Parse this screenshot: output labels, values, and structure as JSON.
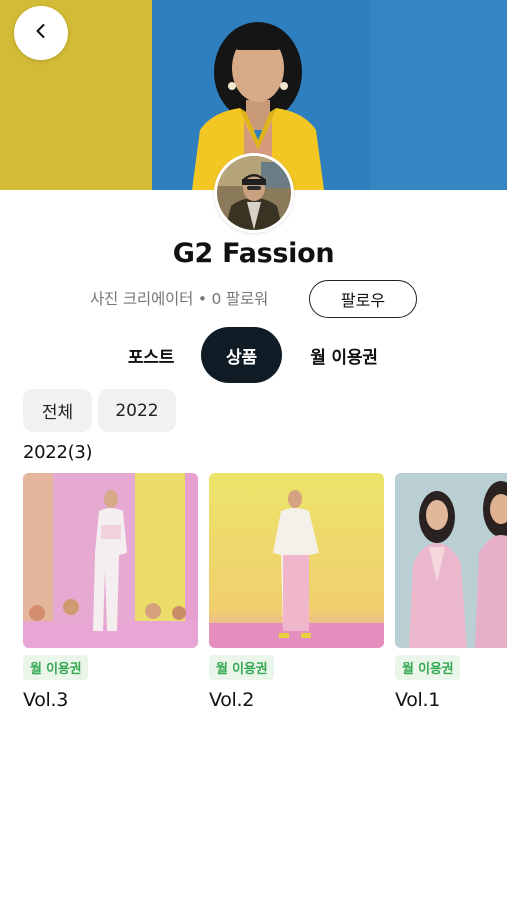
{
  "header": {
    "back_icon": "chevron-left-icon"
  },
  "profile": {
    "name": "G2 Fassion",
    "meta": "사진 크리에이터 • 0 팔로워",
    "follow_label": "팔로우"
  },
  "tabs": [
    {
      "label": "포스트",
      "active": false
    },
    {
      "label": "상품",
      "active": true
    },
    {
      "label": "월 이용권",
      "active": false
    }
  ],
  "filters": [
    {
      "label": "전체"
    },
    {
      "label": "2022"
    }
  ],
  "section": {
    "heading": "2022(3)"
  },
  "products": [
    {
      "badge": "월 이용권",
      "title": "Vol.3"
    },
    {
      "badge": "월 이용권",
      "title": "Vol.2"
    },
    {
      "badge": "월 이용권",
      "title": "Vol.1"
    }
  ],
  "colors": {
    "active_tab_bg": "#0f1c26",
    "badge_text": "#34a853",
    "badge_bg": "#eaf6ea",
    "chip_bg": "#f1f1f1"
  }
}
